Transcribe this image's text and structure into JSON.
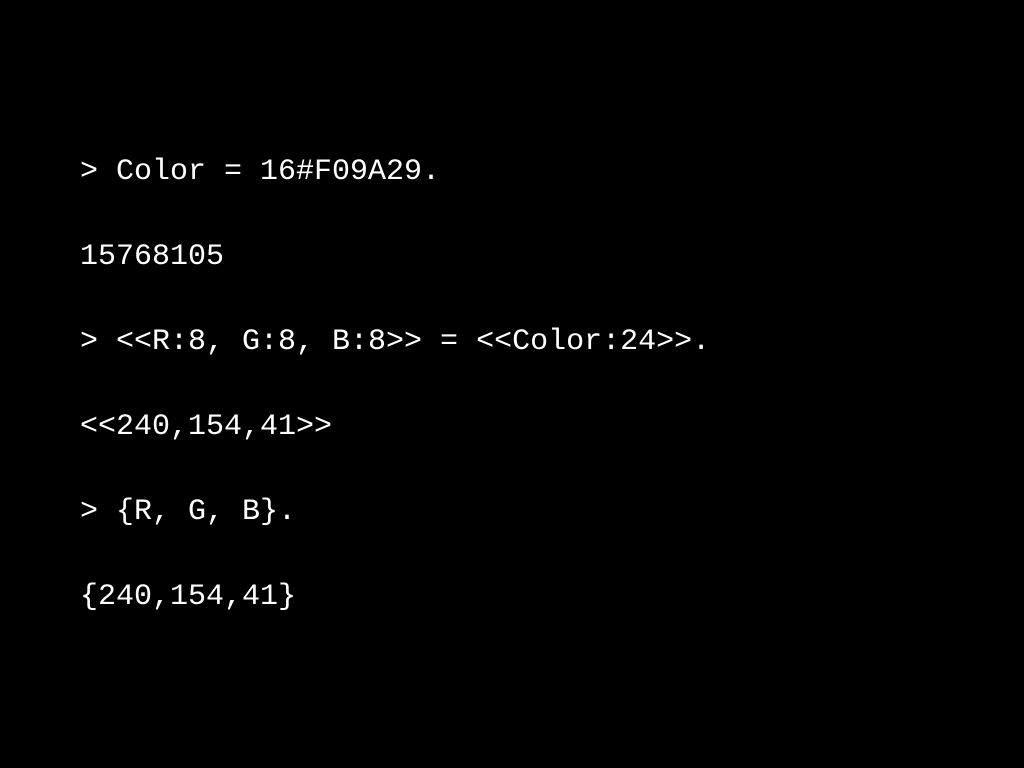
{
  "background": "#000000",
  "text_color": "#ffffff",
  "lines": [
    "> Color = 16#F09A29.",
    "15768105",
    "> <<R:8, G:8, B:8>> = <<Color:24>>.",
    "<<240,154,41>>",
    "> {R, G, B}.",
    "{240,154,41}"
  ]
}
